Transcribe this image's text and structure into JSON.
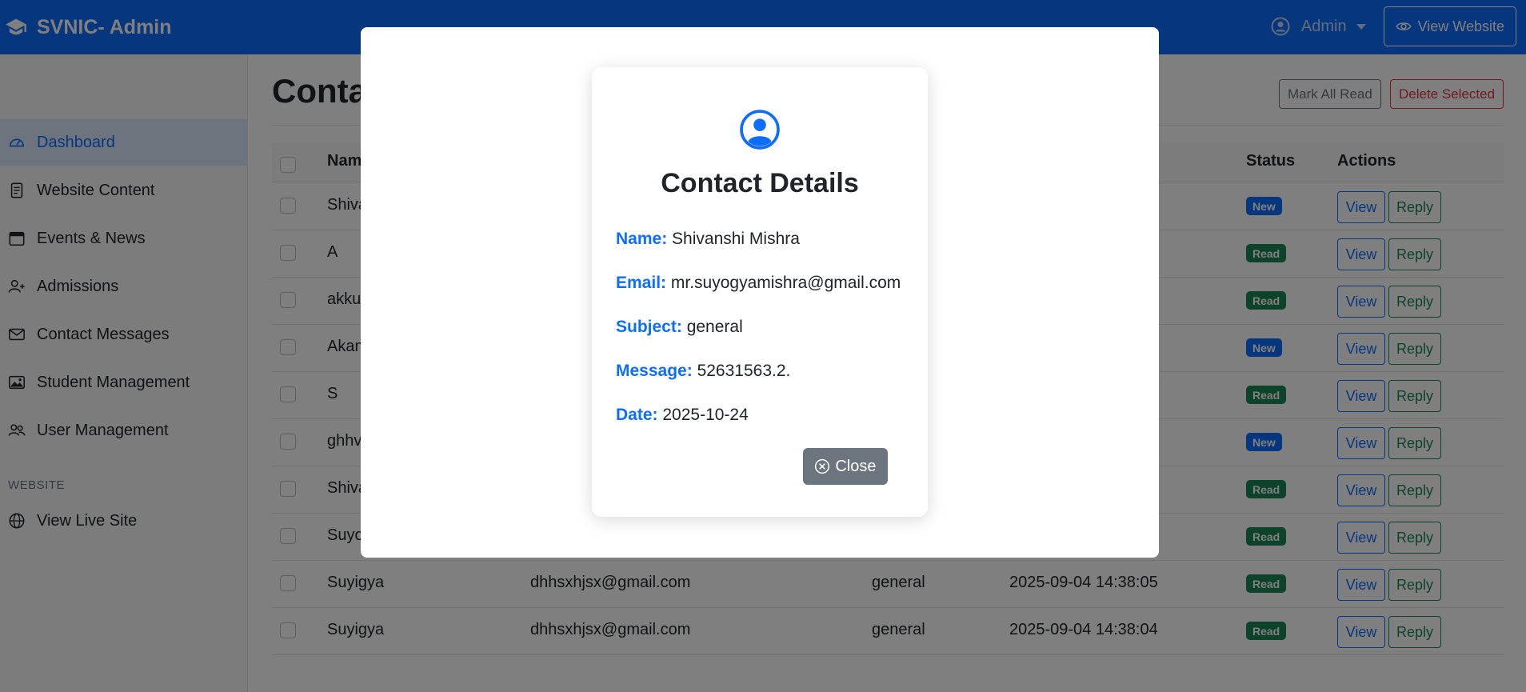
{
  "header": {
    "brand": "SVNIC- Admin",
    "user_menu": "Admin",
    "view_website": "View Website"
  },
  "sidebar": {
    "items": [
      {
        "label": "Dashboard",
        "icon": "speedometer-icon",
        "active": true
      },
      {
        "label": "Website Content",
        "icon": "file-text-icon"
      },
      {
        "label": "Events & News",
        "icon": "calendar-icon"
      },
      {
        "label": "Admissions",
        "icon": "person-plus-icon"
      },
      {
        "label": "Contact Messages",
        "icon": "envelope-icon"
      },
      {
        "label": "Student Management",
        "icon": "images-icon"
      },
      {
        "label": "User Management",
        "icon": "people-icon"
      }
    ],
    "section_heading": "WEBSITE",
    "view_live_site": "View Live Site"
  },
  "page": {
    "title": "Conta",
    "mark_all_read": "Mark All Read",
    "delete_selected": "Delete Selected"
  },
  "table": {
    "headers": {
      "name": "Nam",
      "status": "Status",
      "actions": "Actions"
    },
    "rows": [
      {
        "name": "Shiva",
        "email": "",
        "subject": "",
        "date": "",
        "status": "New"
      },
      {
        "name": "A",
        "email": "",
        "subject": "",
        "date": "",
        "status": "Read"
      },
      {
        "name": "akku",
        "email": "",
        "subject": "",
        "date": "",
        "status": "Read"
      },
      {
        "name": "Akan",
        "email": "",
        "subject": "",
        "date": "",
        "status": "New"
      },
      {
        "name": "S",
        "email": "",
        "subject": "",
        "date": "",
        "status": "Read"
      },
      {
        "name": "ghhv",
        "email": "",
        "subject": "",
        "date": "",
        "status": "New"
      },
      {
        "name": "Shiva",
        "email": "",
        "subject": "",
        "date": "",
        "status": "Read"
      },
      {
        "name": "Suyo",
        "email": "",
        "subject": "",
        "date": "",
        "status": "Read"
      },
      {
        "name": "Suyigya",
        "email": "dhhsxhjsx@gmail.com",
        "subject": "general",
        "date": "2025-09-04 14:38:05",
        "status": "Read"
      },
      {
        "name": "Suyigya",
        "email": "dhhsxhjsx@gmail.com",
        "subject": "general",
        "date": "2025-09-04 14:38:04",
        "status": "Read"
      }
    ],
    "view_label": "View",
    "reply_label": "Reply"
  },
  "modal": {
    "title": "Contact Details",
    "fields": [
      {
        "label": "Name:",
        "value": "Shivanshi Mishra"
      },
      {
        "label": "Email:",
        "value": "mr.suyogyamishra@gmail.com"
      },
      {
        "label": "Subject:",
        "value": "general"
      },
      {
        "label": "Message:",
        "value": "52631563.2."
      },
      {
        "label": "Date:",
        "value": "2025-10-24"
      }
    ],
    "close_label": "Close"
  },
  "colors": {
    "primary": "#0d6efd",
    "success": "#198754",
    "danger": "#dc3545",
    "secondary": "#6c757d"
  }
}
